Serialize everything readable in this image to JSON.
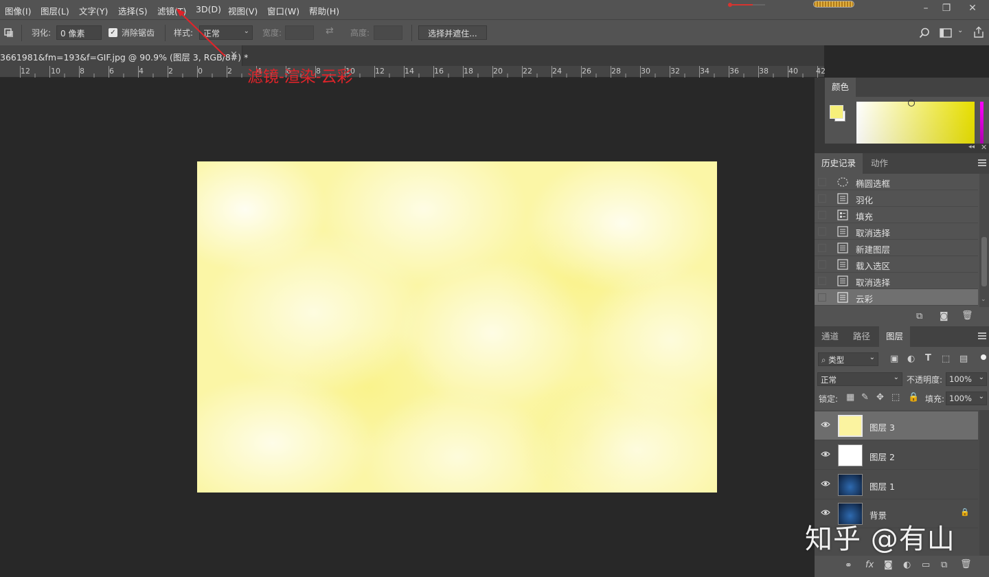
{
  "menubar": {
    "items": [
      "图像(I)",
      "图层(L)",
      "文字(Y)",
      "选择(S)",
      "滤镜(T)",
      "3D(D)",
      "视图(V)",
      "窗口(W)",
      "帮助(H)"
    ],
    "window_controls": {
      "minimize": "–",
      "restore": "❐",
      "close": "✕"
    }
  },
  "options": {
    "feather_label": "羽化:",
    "feather_value": "0 像素",
    "antialias_label": "消除锯齿",
    "antialias_checked": true,
    "style_label": "样式:",
    "style_value": "正常",
    "width_label": "宽度:",
    "height_label": "高度:",
    "select_mask_button": "选择并遮住..."
  },
  "document": {
    "tab_title": "3661981&fm=193&f=GIF.jpg  @  90.9% (图层 3, RGB/8#) *",
    "close_glyph": "×"
  },
  "ruler": {
    "ticks": [
      "12",
      "10",
      "8",
      "6",
      "4",
      "2",
      "0",
      "2",
      "4",
      "6",
      "8",
      "10",
      "12",
      "14",
      "16",
      "18",
      "20",
      "22",
      "24",
      "26",
      "28",
      "30",
      "32",
      "34",
      "36",
      "38",
      "40",
      "42"
    ]
  },
  "annotation": {
    "text": "滤镜-渲染-云彩",
    "color": "#e0242a"
  },
  "color_panel": {
    "tab": "颜色",
    "foreground": "#f7f07a",
    "background": "#ffffff"
  },
  "history_panel": {
    "tabs": [
      "历史记录",
      "动作"
    ],
    "items": [
      {
        "label": "椭圆选框",
        "icon": "ellipse-marquee-icon"
      },
      {
        "label": "羽化",
        "icon": "history-doc-icon"
      },
      {
        "label": "填充",
        "icon": "fill-icon"
      },
      {
        "label": "取消选择",
        "icon": "history-doc-icon"
      },
      {
        "label": "新建图层",
        "icon": "history-doc-icon"
      },
      {
        "label": "载入选区",
        "icon": "history-doc-icon"
      },
      {
        "label": "取消选择",
        "icon": "history-doc-icon"
      },
      {
        "label": "云彩",
        "icon": "history-doc-icon",
        "selected": true
      }
    ]
  },
  "layers_panel": {
    "tabs": [
      "通道",
      "路径",
      "图层"
    ],
    "filter_label": "类型",
    "blend_mode": "正常",
    "opacity_label": "不透明度:",
    "opacity_value": "100%",
    "lock_label": "锁定:",
    "fill_label": "填充:",
    "fill_value": "100%",
    "layers": [
      {
        "name": "图层 3",
        "selected": true,
        "thumb": "yellow"
      },
      {
        "name": "图层 2",
        "selected": false,
        "thumb": "white"
      },
      {
        "name": "图层 1",
        "selected": false,
        "thumb": "dark-blue"
      },
      {
        "name": "背景",
        "selected": false,
        "thumb": "dark-blue",
        "locked": true
      }
    ]
  },
  "watermark": "知乎 @有山"
}
